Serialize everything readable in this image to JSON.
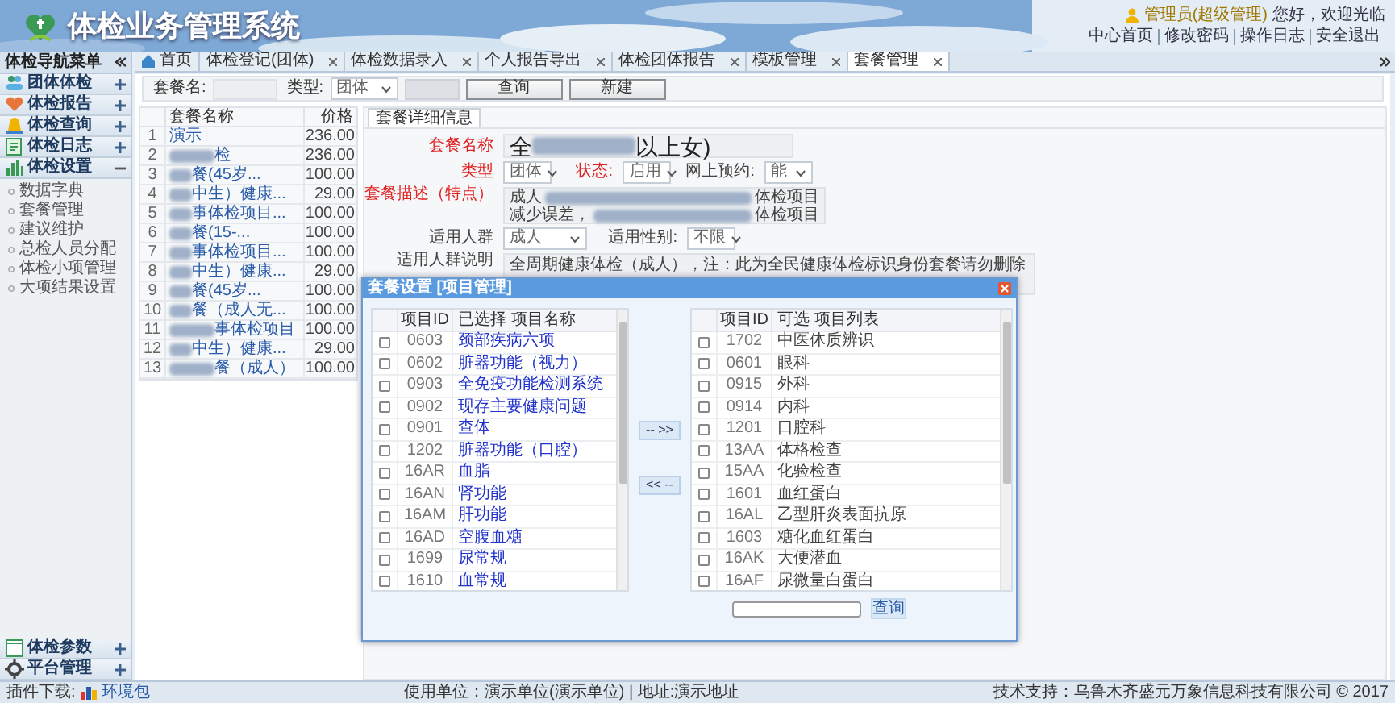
{
  "header": {
    "title": "体检业务管理系统",
    "user": "管理员(超级管理)",
    "greeting": "您好，欢迎光临",
    "links": [
      "中心首页",
      "修改密码",
      "操作日志",
      "安全退出"
    ]
  },
  "sidebar": {
    "title": "体检导航菜单",
    "groups": [
      {
        "label": "团体体检",
        "expanded": false
      },
      {
        "label": "体检报告",
        "expanded": false
      },
      {
        "label": "体检查询",
        "expanded": false
      },
      {
        "label": "体检日志",
        "expanded": false
      },
      {
        "label": "体检设置",
        "expanded": true,
        "children": [
          "数据字典",
          "套餐管理",
          "建议维护",
          "总检人员分配",
          "体检小项管理",
          "大项结果设置"
        ]
      }
    ],
    "bottom_groups": [
      {
        "label": "体检参数",
        "expanded": false
      },
      {
        "label": "平台管理",
        "expanded": false
      }
    ]
  },
  "tabs": [
    {
      "label": "首页",
      "kind": "home",
      "selected": false
    },
    {
      "label": "体检登记(团体)",
      "kind": "page",
      "selected": false
    },
    {
      "label": "体检数据录入",
      "kind": "page",
      "selected": false
    },
    {
      "label": "个人报告导出",
      "kind": "page",
      "selected": false
    },
    {
      "label": "体检团体报告",
      "kind": "page",
      "selected": false
    },
    {
      "label": "模板管理",
      "kind": "page",
      "selected": false
    },
    {
      "label": "套餐管理",
      "kind": "page",
      "selected": true
    }
  ],
  "toolbar": {
    "name_label": "套餐名:",
    "type_label": "类型:",
    "type_value": "团体",
    "buttons": [
      "查询",
      "新建"
    ]
  },
  "package_table": {
    "columns": [
      "套餐名称",
      "价格"
    ],
    "rows": [
      {
        "index": "1",
        "name": "演示",
        "blurred": false,
        "price": "236.00"
      },
      {
        "index": "2",
        "name": "检",
        "blurred": true,
        "price": "236.00"
      },
      {
        "index": "3",
        "name": "餐(45岁...",
        "blurred": true,
        "price": "100.00"
      },
      {
        "index": "4",
        "name": "中生）健康...",
        "blurred": true,
        "price": "29.00"
      },
      {
        "index": "5",
        "name": "事体检项目...",
        "blurred": true,
        "price": "100.00"
      },
      {
        "index": "6",
        "name": "餐(15-...",
        "blurred": true,
        "price": "100.00"
      },
      {
        "index": "7",
        "name": "事体检项目...",
        "blurred": true,
        "price": "100.00"
      },
      {
        "index": "8",
        "name": "中生）健康...",
        "blurred": true,
        "price": "29.00"
      },
      {
        "index": "9",
        "name": "餐(45岁...",
        "blurred": true,
        "price": "100.00"
      },
      {
        "index": "10",
        "name": "餐（成人无...",
        "blurred": true,
        "price": "100.00"
      },
      {
        "index": "11",
        "name": "事体检项目",
        "blurred": true,
        "price": "100.00"
      },
      {
        "index": "12",
        "name": "中生）健康...",
        "blurred": true,
        "price": "29.00"
      },
      {
        "index": "13",
        "name": "餐（成人）",
        "blurred": true,
        "price": "100.00"
      }
    ]
  },
  "detail": {
    "tab": "套餐详细信息",
    "name": {
      "label": "套餐名称",
      "value_start": "全",
      "value_end": "以上女)",
      "blurred": true
    },
    "type": {
      "label": "类型",
      "value": "团体"
    },
    "status": {
      "label": "状态:",
      "value": "启用"
    },
    "online": {
      "label": "网上预约:",
      "value": "能"
    },
    "description": {
      "label": "套餐描述（特点）",
      "lines": [
        {
          "start": "成人",
          "end": "体检项目"
        },
        {
          "start": "减少误差，",
          "end": "体检项目"
        }
      ]
    },
    "crowd": {
      "label": "适用人群",
      "value": "成人"
    },
    "gender": {
      "label": "适用性别:",
      "value": "不限"
    },
    "crowd_note": {
      "label": "适用人群说明",
      "value": "全周期健康体检（成人），注：此为全民健康体检标识身份套餐请勿删除"
    }
  },
  "dialog": {
    "title": "套餐设置 [项目管理]",
    "selected_list": {
      "columns": [
        "项目ID",
        "已选择 项目名称"
      ],
      "items": [
        {
          "id": "0603",
          "name": "颈部疾病六项",
          "checked": false
        },
        {
          "id": "0602",
          "name": "脏器功能（视力）",
          "checked": false
        },
        {
          "id": "0903",
          "name": "全免疫功能检测系统",
          "checked": false
        },
        {
          "id": "0902",
          "name": "现存主要健康问题",
          "checked": false
        },
        {
          "id": "0901",
          "name": "查体",
          "checked": false
        },
        {
          "id": "1202",
          "name": "脏器功能（口腔）",
          "checked": false
        },
        {
          "id": "16AR",
          "name": "血脂",
          "checked": false
        },
        {
          "id": "16AN",
          "name": "肾功能",
          "checked": false
        },
        {
          "id": "16AM",
          "name": "肝功能",
          "checked": false
        },
        {
          "id": "16AD",
          "name": "空腹血糖",
          "checked": false
        },
        {
          "id": "1699",
          "name": "尿常规",
          "checked": false
        },
        {
          "id": "1610",
          "name": "血常规",
          "checked": false
        }
      ]
    },
    "move_buttons": [
      "-- >>",
      "<< --"
    ],
    "available_list": {
      "columns": [
        "项目ID",
        "可选 项目列表"
      ],
      "items": [
        {
          "id": "1702",
          "name": "中医体质辨识",
          "checked": false
        },
        {
          "id": "0601",
          "name": "眼科",
          "checked": false
        },
        {
          "id": "0915",
          "name": "外科",
          "checked": false
        },
        {
          "id": "0914",
          "name": "内科",
          "checked": false
        },
        {
          "id": "1201",
          "name": "口腔科",
          "checked": false
        },
        {
          "id": "13AA",
          "name": "体格检查",
          "checked": false
        },
        {
          "id": "15AA",
          "name": "化验检查",
          "checked": false
        },
        {
          "id": "1601",
          "name": "血红蛋白",
          "checked": false
        },
        {
          "id": "16AL",
          "name": "乙型肝炎表面抗原",
          "checked": false
        },
        {
          "id": "1603",
          "name": "糖化血红蛋白",
          "checked": false
        },
        {
          "id": "16AK",
          "name": "大便潜血",
          "checked": false
        },
        {
          "id": "16AF",
          "name": "尿微量白蛋白",
          "checked": false
        }
      ]
    },
    "search_button": "查询"
  },
  "status_bar": {
    "plugin_label": "插件下载:",
    "plugin_link": "环境包",
    "unit": "使用单位：演示单位(演示单位) | 地址:演示地址",
    "support": "技术支持：乌鲁木齐盛元万象信息科技有限公司 © 2017"
  }
}
